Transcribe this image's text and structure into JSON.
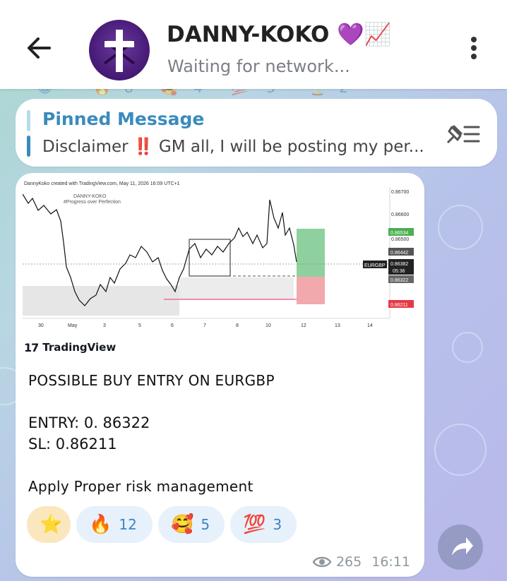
{
  "header": {
    "title": "DANNY-KOKO",
    "title_emojis": "💜📈",
    "subtitle": "Waiting for network..."
  },
  "prev_reactions": [
    "8",
    "4",
    "3",
    "2"
  ],
  "pinned": {
    "title": "Pinned Message",
    "text": "Disclaimer ‼️  GM all, I will be posting my per..."
  },
  "chart": {
    "watermark": "DannyKoko created with TradingView.com, May 11, 2026 16:09 UTC+1",
    "author": "DANNY-KOKO",
    "tagline": "#Progress over Perfection",
    "symbol": "EURGBP",
    "prices": [
      "0.86700",
      "0.86600",
      "0.86500",
      "0.86534",
      "0.86442",
      "0.86382",
      "05:36",
      "0.86322",
      "0.86211"
    ],
    "dates": [
      "30",
      "May",
      "3",
      "5",
      "6",
      "7",
      "8",
      "10",
      "12",
      "13",
      "14"
    ],
    "brand": "TradingView"
  },
  "message": {
    "line1": "POSSIBLE BUY ENTRY ON EURGBP",
    "entry": "ENTRY: 0. 86322",
    "sl": "SL: 0.86211",
    "note": "Apply Proper risk management"
  },
  "reactions": [
    {
      "emoji": "⭐",
      "count": ""
    },
    {
      "emoji": "🔥",
      "count": "12"
    },
    {
      "emoji": "🥰",
      "count": "5"
    },
    {
      "emoji": "💯",
      "count": "3"
    }
  ],
  "meta": {
    "views": "265",
    "time": "16:11"
  },
  "colors": {
    "accent": "#3a8bbd",
    "avatar": "#4a1d7a",
    "profit_zone": "#8fd19e",
    "loss_zone": "#f2a9ad"
  }
}
